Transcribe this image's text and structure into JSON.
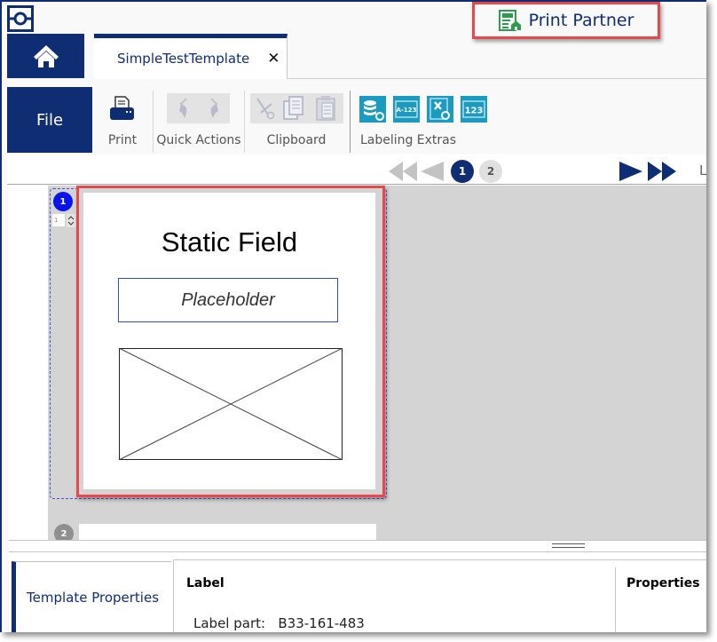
{
  "app": {
    "print_partner_label": "Print Partner"
  },
  "tabs": {
    "home_icon": "home-icon",
    "document_tab": "SimpleTestTemplate",
    "close_glyph": "✕"
  },
  "ribbon": {
    "file_label": "File",
    "groups": [
      {
        "label": "Print",
        "icons": [
          "printer-icon"
        ],
        "enabled": true
      },
      {
        "label": "Quick Actions",
        "icons": [
          "undo-icon",
          "redo-icon"
        ],
        "enabled": false
      },
      {
        "label": "Clipboard",
        "icons": [
          "cut-icon",
          "copy-icon",
          "paste-icon"
        ],
        "enabled": false
      },
      {
        "label": "Labeling Extras",
        "icons": [
          "database-connect-icon",
          "serialized-text-icon",
          "excel-connect-icon",
          "sequence-123-icon"
        ],
        "enabled": true
      }
    ],
    "extras_icon_texts": {
      "serialized": "A-123",
      "sequence": "123"
    }
  },
  "pager": {
    "pages": [
      "1",
      "2"
    ],
    "current_page": "1",
    "trailing_text": "L"
  },
  "canvas": {
    "label_number_badge": "1",
    "quantity_value": "1",
    "static_field_text": "Static Field",
    "placeholder_text": "Placeholder",
    "second_label_badge": "2"
  },
  "bottom_panel": {
    "tab_label": "Template Properties",
    "label_heading": "Label",
    "label_part_text": "Label part:   B33-161-483",
    "properties_heading": "Properties"
  },
  "colors": {
    "brand_navy": "#0f2d73",
    "highlight_red": "#e8474b",
    "teal_icon": "#1a9bbf",
    "print_partner_green": "#2e9c4d",
    "selection_blue": "#4b4bd9",
    "badge_blue": "#0a14e6"
  }
}
